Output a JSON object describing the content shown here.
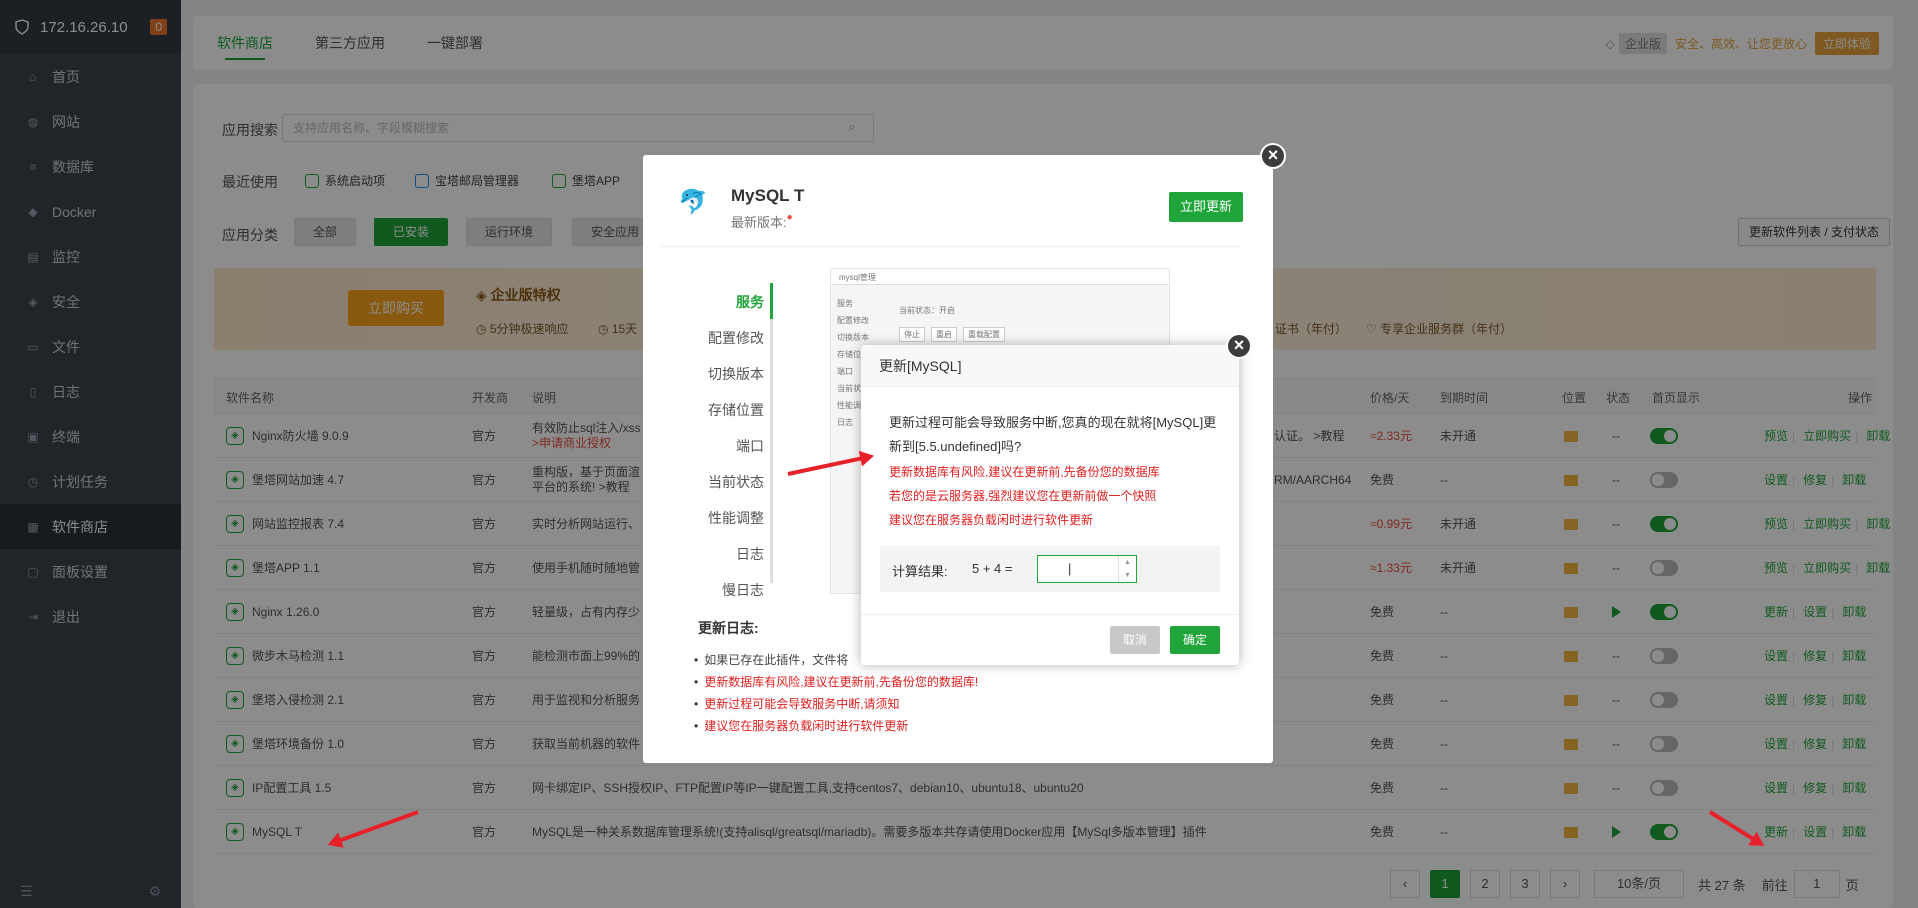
{
  "sidebar": {
    "ip": "172.16.26.10",
    "badge": "0",
    "items": [
      {
        "label": "首页",
        "icon": "home-icon"
      },
      {
        "label": "网站",
        "icon": "globe-icon"
      },
      {
        "label": "数据库",
        "icon": "database-icon"
      },
      {
        "label": "Docker",
        "icon": "docker-icon"
      },
      {
        "label": "监控",
        "icon": "monitor-icon"
      },
      {
        "label": "安全",
        "icon": "shield-icon"
      },
      {
        "label": "文件",
        "icon": "folder-icon"
      },
      {
        "label": "日志",
        "icon": "log-icon"
      },
      {
        "label": "终端",
        "icon": "terminal-icon"
      },
      {
        "label": "计划任务",
        "icon": "clock-icon"
      },
      {
        "label": "软件商店",
        "icon": "grid-icon",
        "active": true
      },
      {
        "label": "面板设置",
        "icon": "settings-icon"
      },
      {
        "label": "退出",
        "icon": "logout-icon"
      }
    ]
  },
  "topbar": {
    "tabs": [
      "软件商店",
      "第三方应用",
      "一键部署"
    ],
    "ent_tag": "企业版",
    "ent_slogan": "安全、高效、让您更放心",
    "ent_try": "立即体验"
  },
  "search": {
    "label": "应用搜索",
    "placeholder": "支持应用名称、字段模糊搜索"
  },
  "recent": {
    "label": "最近使用",
    "items": [
      "系统启动项",
      "宝塔邮局管理器",
      "堡塔APP"
    ]
  },
  "categories": {
    "label": "应用分类",
    "items": [
      "全部",
      "已安装",
      "运行环境",
      "安全应用"
    ],
    "list_btn": "更新软件列表 / 支付状态"
  },
  "banner": {
    "buy": "立即购买",
    "ent_privilege": "企业版特权",
    "f1": "5分钟极速响应",
    "f2": "15天",
    "f3": "证书（年付）",
    "f4": "专享企业服务群（年付）"
  },
  "table": {
    "headers": [
      "软件名称",
      "开发商",
      "说明",
      "价格/天",
      "到期时间",
      "位置",
      "状态",
      "首页显示",
      "操作"
    ],
    "rows": [
      {
        "name": "Nginx防火墙 9.0.9",
        "dev": "官方",
        "desc": "有效防止sql注入/xss",
        "desc2": ">申请商业授权",
        "extra": "认证。 >教程",
        "price": "≈2.33元",
        "price_red": true,
        "expire": "未开通",
        "play": false,
        "switch": true,
        "ops": [
          "预览",
          "立即购买",
          "卸载"
        ]
      },
      {
        "name": "堡塔网站加速 4.7",
        "dev": "官方",
        "desc": "重构版，基于页面渲",
        "desc2": "平台的系统! >教程",
        "extra": "RM/AARCH64",
        "price": "免费",
        "price_red": false,
        "expire": "--",
        "play": false,
        "switch": false,
        "ops": [
          "设置",
          "修复",
          "卸载"
        ]
      },
      {
        "name": "网站监控报表 7.4",
        "dev": "官方",
        "desc": "实时分析网站运行、",
        "desc2": "",
        "extra": "",
        "price": "≈0.99元",
        "price_red": true,
        "expire": "未开通",
        "play": false,
        "switch": true,
        "ops": [
          "预览",
          "立即购买",
          "卸载"
        ]
      },
      {
        "name": "堡塔APP 1.1",
        "dev": "官方",
        "desc": "使用手机随时随地管",
        "desc2": "",
        "extra": "",
        "price": "≈1.33元",
        "price_red": true,
        "expire": "未开通",
        "play": false,
        "switch": false,
        "ops": [
          "预览",
          "立即购买",
          "卸载"
        ]
      },
      {
        "name": "Nginx 1.26.0",
        "dev": "官方",
        "desc": "轻量级，占有内存少",
        "desc2": "",
        "extra": "",
        "price": "免费",
        "price_red": false,
        "expire": "--",
        "play": true,
        "switch": true,
        "ops": [
          "更新",
          "设置",
          "卸载"
        ]
      },
      {
        "name": "微步木马检测 1.1",
        "dev": "官方",
        "desc": "能检测市面上99%的",
        "desc2": "",
        "extra": "",
        "price": "免费",
        "price_red": false,
        "expire": "--",
        "play": false,
        "switch": false,
        "ops": [
          "设置",
          "修复",
          "卸载"
        ]
      },
      {
        "name": "堡塔入侵检测 2.1",
        "dev": "官方",
        "desc": "用于监视和分析服务",
        "desc2": "",
        "extra": "",
        "price": "免费",
        "price_red": false,
        "expire": "--",
        "play": false,
        "switch": false,
        "ops": [
          "设置",
          "修复",
          "卸载"
        ]
      },
      {
        "name": "堡塔环境备份 1.0",
        "dev": "官方",
        "desc": "获取当前机器的软件",
        "desc2": "",
        "extra": "",
        "price": "免费",
        "price_red": false,
        "expire": "--",
        "play": false,
        "switch": false,
        "ops": [
          "设置",
          "修复",
          "卸载"
        ]
      },
      {
        "name": "IP配置工具 1.5",
        "dev": "官方",
        "desc": "网卡绑定IP、SSH授权IP、FTP配置IP等IP一键配置工具,支持centos7、debian10、ubuntu18、ubuntu20",
        "desc2": "",
        "extra": "",
        "price": "免费",
        "price_red": false,
        "expire": "--",
        "play": false,
        "switch": false,
        "ops": [
          "设置",
          "修复",
          "卸载"
        ]
      },
      {
        "name": "MySQL T",
        "dev": "官方",
        "desc": "MySQL是一种关系数据库管理系统!(支持alisql/greatsql/mariadb)。需要多版本共存请使用Docker应用【MySql多版本管理】插件",
        "desc2": "",
        "extra": "",
        "price": "免费",
        "price_red": false,
        "expire": "--",
        "play": true,
        "switch": true,
        "ops": [
          "更新",
          "设置",
          "卸载"
        ]
      }
    ]
  },
  "pager": {
    "pages": [
      "1",
      "2",
      "3"
    ],
    "per_page": "10条/页",
    "total": "共 27 条",
    "goto": "前往",
    "goto_val": "1",
    "page_unit": "页"
  },
  "app_dialog": {
    "title": "MySQL T",
    "version_label": "最新版本:",
    "update_btn": "立即更新",
    "menu": [
      "服务",
      "配置修改",
      "切换版本",
      "存储位置",
      "端口",
      "当前状态",
      "性能调整",
      "日志",
      "慢日志"
    ],
    "preview_title": "mysql管理",
    "preview_status": "当前状态：开启",
    "preview_btns": [
      "停止",
      "重启",
      "重载配置"
    ],
    "preview_menu": [
      "服务",
      "配置修改",
      "切换版本",
      "存储位置",
      "端口",
      "当前状态",
      "性能调整",
      "日志"
    ],
    "log_title": "更新日志:",
    "logs": [
      {
        "text": "如果已存在此插件，文件将",
        "red": false
      },
      {
        "text": "更新数据库有风险,建议在更新前,先备份您的数据库!",
        "red": true
      },
      {
        "text": "更新过程可能会导致服务中断,请须知",
        "red": true
      },
      {
        "text": "建议您在服务器负载闲时进行软件更新",
        "red": true
      }
    ]
  },
  "confirm_dialog": {
    "title": "更新[MySQL]",
    "msg1": "更新过程可能会导致服务中断,您真的现在就将[MySQL]更",
    "msg2": "新到[5.5.undefined]吗?",
    "warn1": "更新数据库有风险,建议在更新前,先备份您的数据库",
    "warn2": "若您的是云服务器,强烈建议您在更新前做一个快照",
    "warn3": "建议您在服务器负载闲时进行软件更新",
    "calc_label": "计算结果:",
    "calc_expr": "5 + 4  =",
    "cancel": "取消",
    "ok": "确定"
  },
  "colors": {
    "accent": "#20a53a",
    "warn": "#e74c3c",
    "sidebar": "#3c444d",
    "arrow": "#e8202a"
  }
}
